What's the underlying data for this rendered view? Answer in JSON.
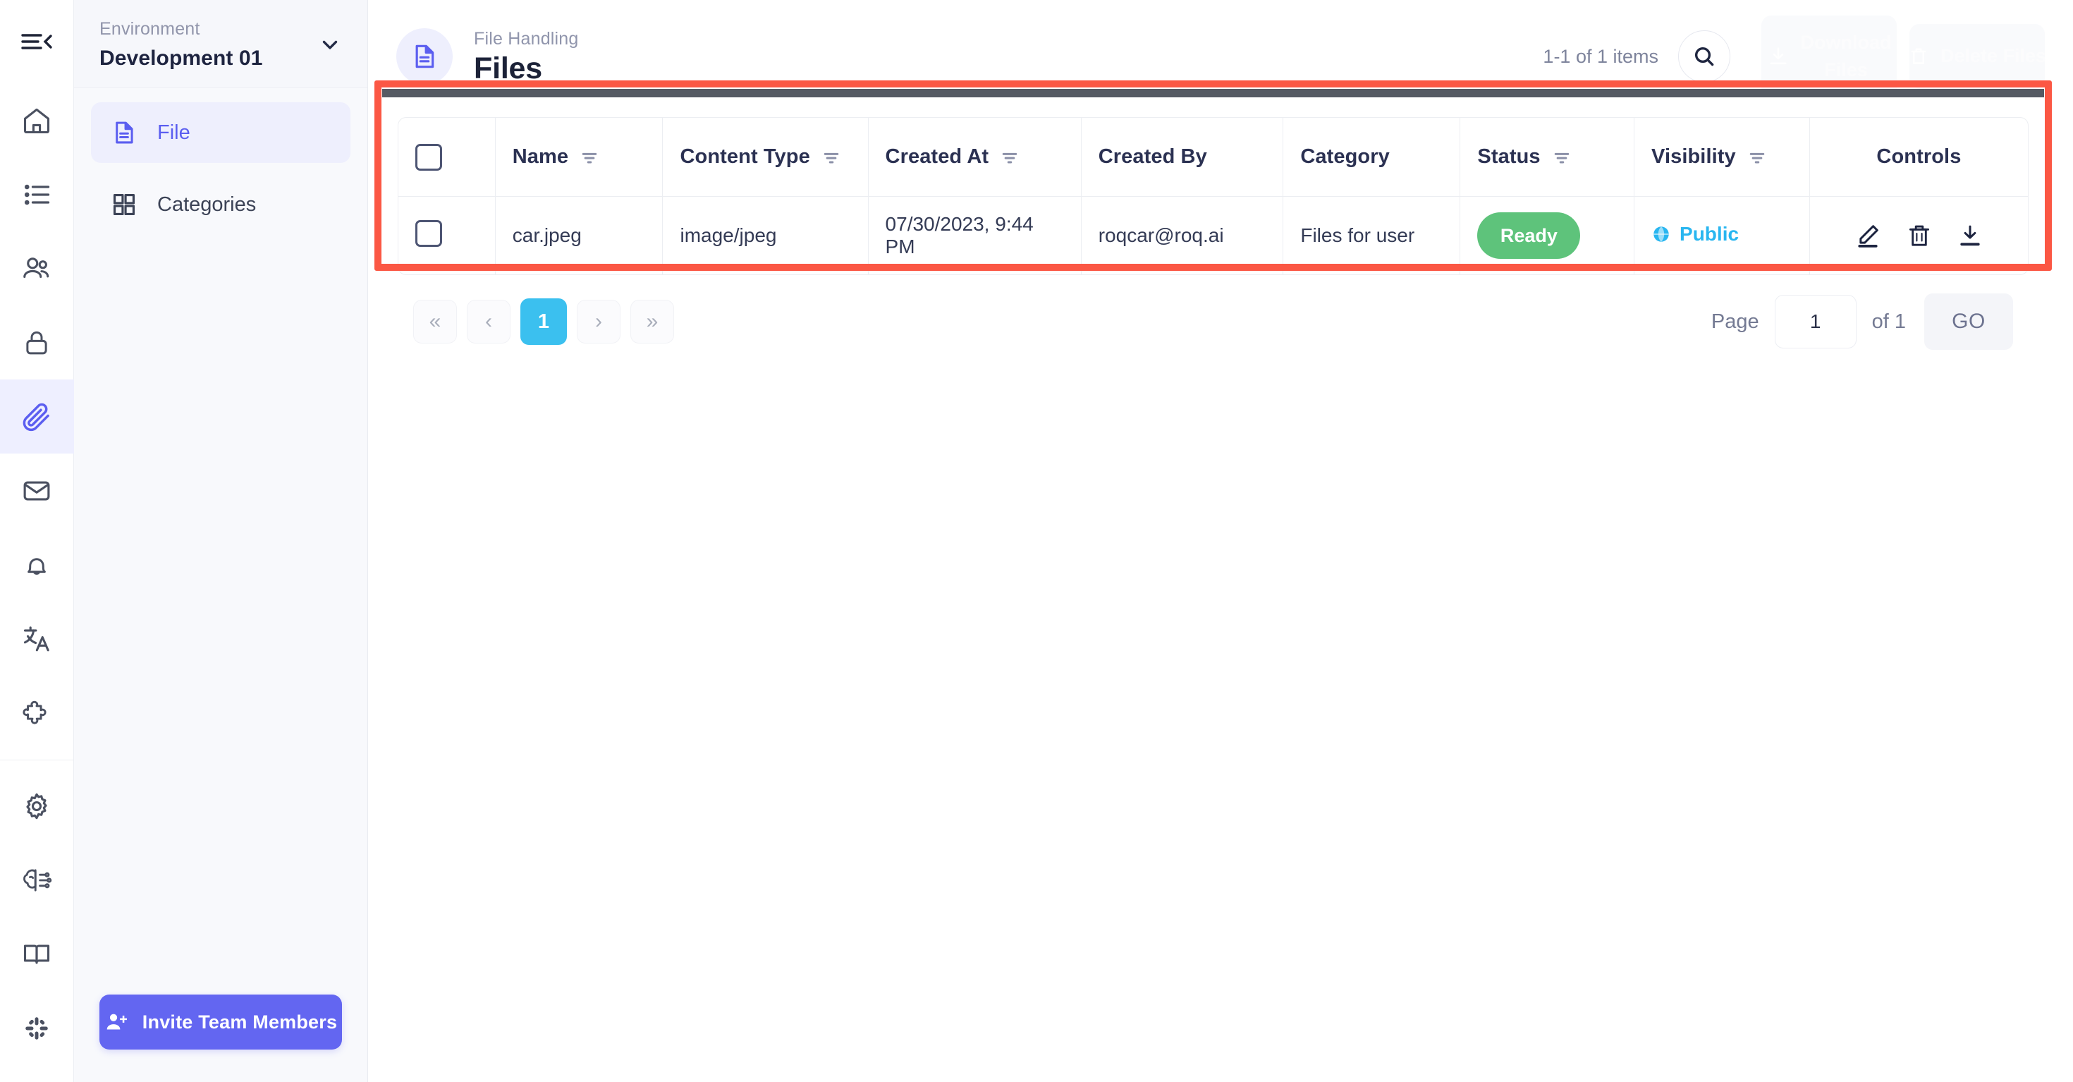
{
  "rail": {
    "items": [
      {
        "name": "collapse-menu-icon",
        "label": "Collapse menu"
      },
      {
        "name": "home-icon",
        "label": "Home"
      },
      {
        "name": "list-icon",
        "label": "Lists"
      },
      {
        "name": "users-icon",
        "label": "Users"
      },
      {
        "name": "lock-icon",
        "label": "Security"
      },
      {
        "name": "paperclip-icon",
        "label": "File Handling"
      },
      {
        "name": "mail-icon",
        "label": "Mail"
      },
      {
        "name": "bell-icon",
        "label": "Notifications"
      },
      {
        "name": "translate-icon",
        "label": "Translations"
      },
      {
        "name": "puzzle-icon",
        "label": "Integrations"
      },
      {
        "name": "gear-icon",
        "label": "Settings"
      },
      {
        "name": "ai-brain-icon",
        "label": "AI"
      },
      {
        "name": "book-icon",
        "label": "Docs"
      },
      {
        "name": "slack-icon",
        "label": "Slack"
      }
    ]
  },
  "sidebar": {
    "environment_label": "Environment",
    "environment_value": "Development 01",
    "items": [
      {
        "label": "File",
        "icon": "file-icon",
        "active": true
      },
      {
        "label": "Categories",
        "icon": "grid-icon",
        "active": false
      }
    ],
    "invite_label": "Invite Team Members"
  },
  "header": {
    "breadcrumb": "File Handling",
    "title": "Files",
    "items_count": "1-1 of 1 items",
    "download_label": "Download Files",
    "delete_label": "Delete Files"
  },
  "table": {
    "columns": [
      {
        "label": "",
        "filter": false
      },
      {
        "label": "Name",
        "filter": true
      },
      {
        "label": "Content Type",
        "filter": true
      },
      {
        "label": "Created At",
        "filter": true
      },
      {
        "label": "Created By",
        "filter": false
      },
      {
        "label": "Category",
        "filter": false
      },
      {
        "label": "Status",
        "filter": true
      },
      {
        "label": "Visibility",
        "filter": true
      },
      {
        "label": "Controls",
        "filter": false
      }
    ],
    "rows": [
      {
        "name": "car.jpeg",
        "content_type": "image/jpeg",
        "created_at": "07/30/2023, 9:44 PM",
        "created_by": "roqcar@roq.ai",
        "category": "Files for user",
        "status": "Ready",
        "visibility": "Public"
      }
    ]
  },
  "pagination": {
    "first": "«",
    "prev": "‹",
    "current": "1",
    "next": "›",
    "last": "»",
    "page_label": "Page",
    "page_value": "1",
    "of_label": "of 1",
    "go_label": "GO"
  },
  "colors": {
    "accent": "#6366f1",
    "status_ready": "#5ec37b",
    "visibility_public": "#29b6f0",
    "pager_active": "#3bc0ef",
    "highlight": "#fb5744"
  }
}
